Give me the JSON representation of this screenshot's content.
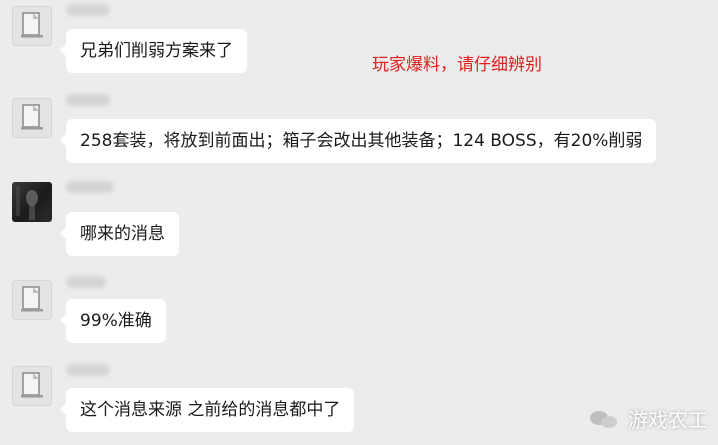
{
  "annotation": "玩家爆料，请仔细辨别",
  "messages": [
    {
      "avatar": "default-avatar",
      "text": "兄弟们削弱方案来了"
    },
    {
      "avatar": "default-avatar",
      "text": "258套装，将放到前面出；箱子会改出其他装备；124 BOSS，有20%削弱"
    },
    {
      "avatar": "photo-avatar",
      "text": "哪来的消息"
    },
    {
      "avatar": "default-avatar",
      "text": "99%准确"
    },
    {
      "avatar": "default-avatar",
      "text": "这个消息来源 之前给的消息都中了"
    }
  ],
  "watermark": "游戏农工",
  "colors": {
    "background": "#ececec",
    "bubble": "#ffffff",
    "annotation": "#e02020"
  }
}
